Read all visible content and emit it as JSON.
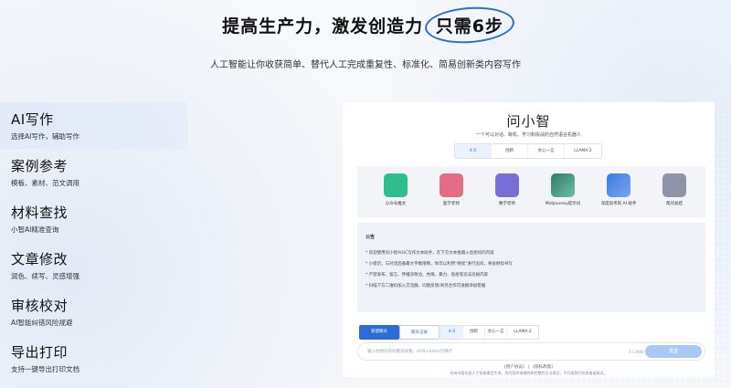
{
  "hero": {
    "title_prefix": "提高生产力，激发创造力",
    "title_highlight": "只需6步",
    "subtitle": "人工智能让你收获简单、替代人工完成重复性、标准化、简易创新类内容写作"
  },
  "features": [
    {
      "title": "AI写作",
      "desc": "选择AI写作，辅助写作"
    },
    {
      "title": "案例参考",
      "desc": "模板、素材、范文调用"
    },
    {
      "title": "材料查找",
      "desc": "小智AI精准查询"
    },
    {
      "title": "文章修改",
      "desc": "润色、续写、灵感增强"
    },
    {
      "title": "审核校对",
      "desc": "AI智能纠错风险规避"
    },
    {
      "title": "导出打印",
      "desc": "支持一键导出打印文档"
    }
  ],
  "preview": {
    "app_name": "问小智",
    "tagline": "一个可以对话、聊机、学习和挑战的自然语言机器人",
    "model_tabs": [
      "4.0",
      "创新",
      "文心一言",
      "LLAMA-2"
    ],
    "apps": [
      {
        "label": "公众号推文",
        "color": "#2fbf8f"
      },
      {
        "label": "医学老师",
        "color": "#e26d84"
      },
      {
        "label": "数学老师",
        "color": "#7a6fd6"
      },
      {
        "label": "Midjourney提示词",
        "color": "#3f9a84"
      },
      {
        "label": "深度思考的 AI 助手",
        "color": "#4e8fe6"
      },
      {
        "label": "帮问总结",
        "color": "#8f95a6"
      }
    ],
    "notice_title": "公告",
    "notice_lines": [
      "* 欢迎使用问小智AIGC写作文本助手，在下方文本框输入您想问的内容",
      "* 小提示，与对话后备最大字数限制，你可以利用\"继续\"进行追问，将会继续书写",
      "* 严禁发布、留言、传播涉政治、色情、暴力、低俗等违法违规内容",
      "* 扫描下方二维码加入交流群，问题反馈/商务合作可进群添加客服"
    ],
    "action_primary": "新建聊天",
    "action_secondary": "聊天记录",
    "small_tabs": [
      "4.0",
      "创新",
      "文心一言",
      "LLAMA-2"
    ],
    "input_placeholder": "输入你想问的问题试试看，shift+Enter可换行",
    "input_counter": "0 / 2000",
    "send_label": "发送",
    "footer_links": "《用户协议》 | 《隐私政策》",
    "footer_note": "所有内容均由人工智能模型生成，其内容的准确性和完整性无法保证，不代表我们的态度或观点。"
  }
}
